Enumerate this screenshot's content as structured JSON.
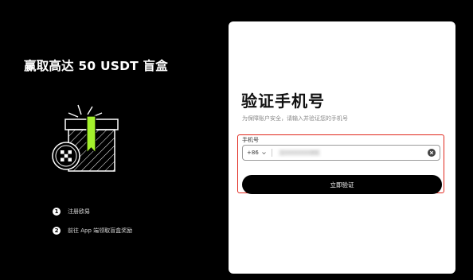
{
  "promo": {
    "title": "赢取高达 50 USDT 盲盒",
    "steps": [
      {
        "number": "1",
        "text": "注册欧易"
      },
      {
        "number": "2",
        "text": "前往 App 端领取盲盒奖励"
      }
    ]
  },
  "form": {
    "title": "验证手机号",
    "subtitle": "为保障账户安全，请输入并验证您的手机号",
    "phone_label": "手机号",
    "country_code": "+86",
    "phone_value": "1••••••••89",
    "submit_label": "立即验证"
  },
  "colors": {
    "background": "#000000",
    "accent_green": "#a4f12c",
    "highlight_red": "#e0261b",
    "button": "#000000"
  },
  "icons": [
    "gift-box-icon",
    "okx-logo-icon",
    "chevron-down-icon",
    "clear-icon"
  ]
}
